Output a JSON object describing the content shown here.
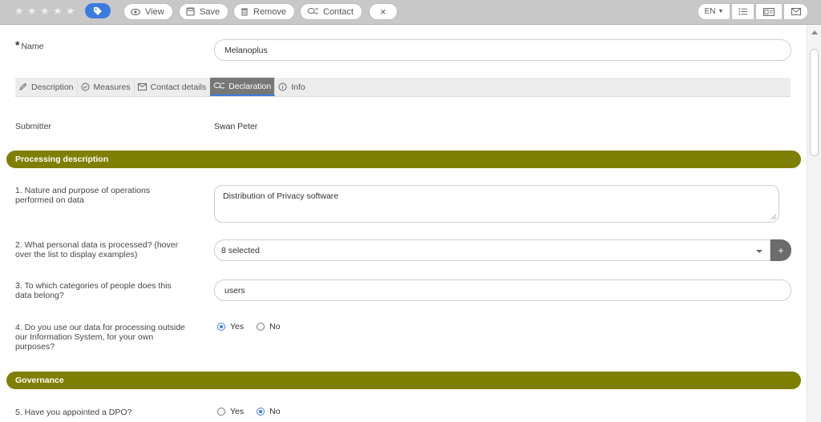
{
  "toolbar": {
    "rating_stars": 5,
    "tag_icon": "tag-icon",
    "buttons": {
      "view": "View",
      "save": "Save",
      "remove": "Remove",
      "contact": "Contact",
      "close": "×"
    },
    "language": "EN",
    "colors": {
      "bar": "#c8c8c8",
      "tag": "#3b7be0"
    }
  },
  "form": {
    "name": {
      "label": "Name",
      "value": "Melanoplus"
    },
    "tabs": [
      {
        "label": "Description",
        "icon": "pencil-icon"
      },
      {
        "label": "Measures",
        "icon": "check-circle-icon"
      },
      {
        "label": "Contact details",
        "icon": "envelope-icon"
      },
      {
        "label": "Declaration",
        "icon": "chat-icon",
        "active": true
      },
      {
        "label": "Info",
        "icon": "info-icon"
      }
    ],
    "submitter": {
      "label": "Submitter",
      "value": "Swan Peter"
    }
  },
  "sections": {
    "processing": {
      "title": "Processing description",
      "color": "#7f7f06"
    },
    "governance": {
      "title": "Governance",
      "color": "#7f7f06"
    }
  },
  "questions": {
    "q1": {
      "label_line1": "1. Nature and purpose of operations",
      "label_line2": "performed on data",
      "value": "Distribution of Privacy software"
    },
    "q2": {
      "label_line1": "2. What personal data is processed? (hover",
      "label_line2": "over the list to display examples)",
      "value": "8 selected",
      "add": "+"
    },
    "q3": {
      "label_line1": "3. To which categories of people does this",
      "label_line2": "data belong?",
      "value": "users"
    },
    "q4": {
      "label_line1": "4. Do you use our data for processing outside",
      "label_line2": "our Information System, for your own",
      "label_line3": "purposes?",
      "yes": "Yes",
      "no": "No",
      "selected": "Yes"
    },
    "q5": {
      "label": "5. Have you appointed a DPO?",
      "yes": "Yes",
      "no": "No",
      "selected": "No"
    }
  }
}
